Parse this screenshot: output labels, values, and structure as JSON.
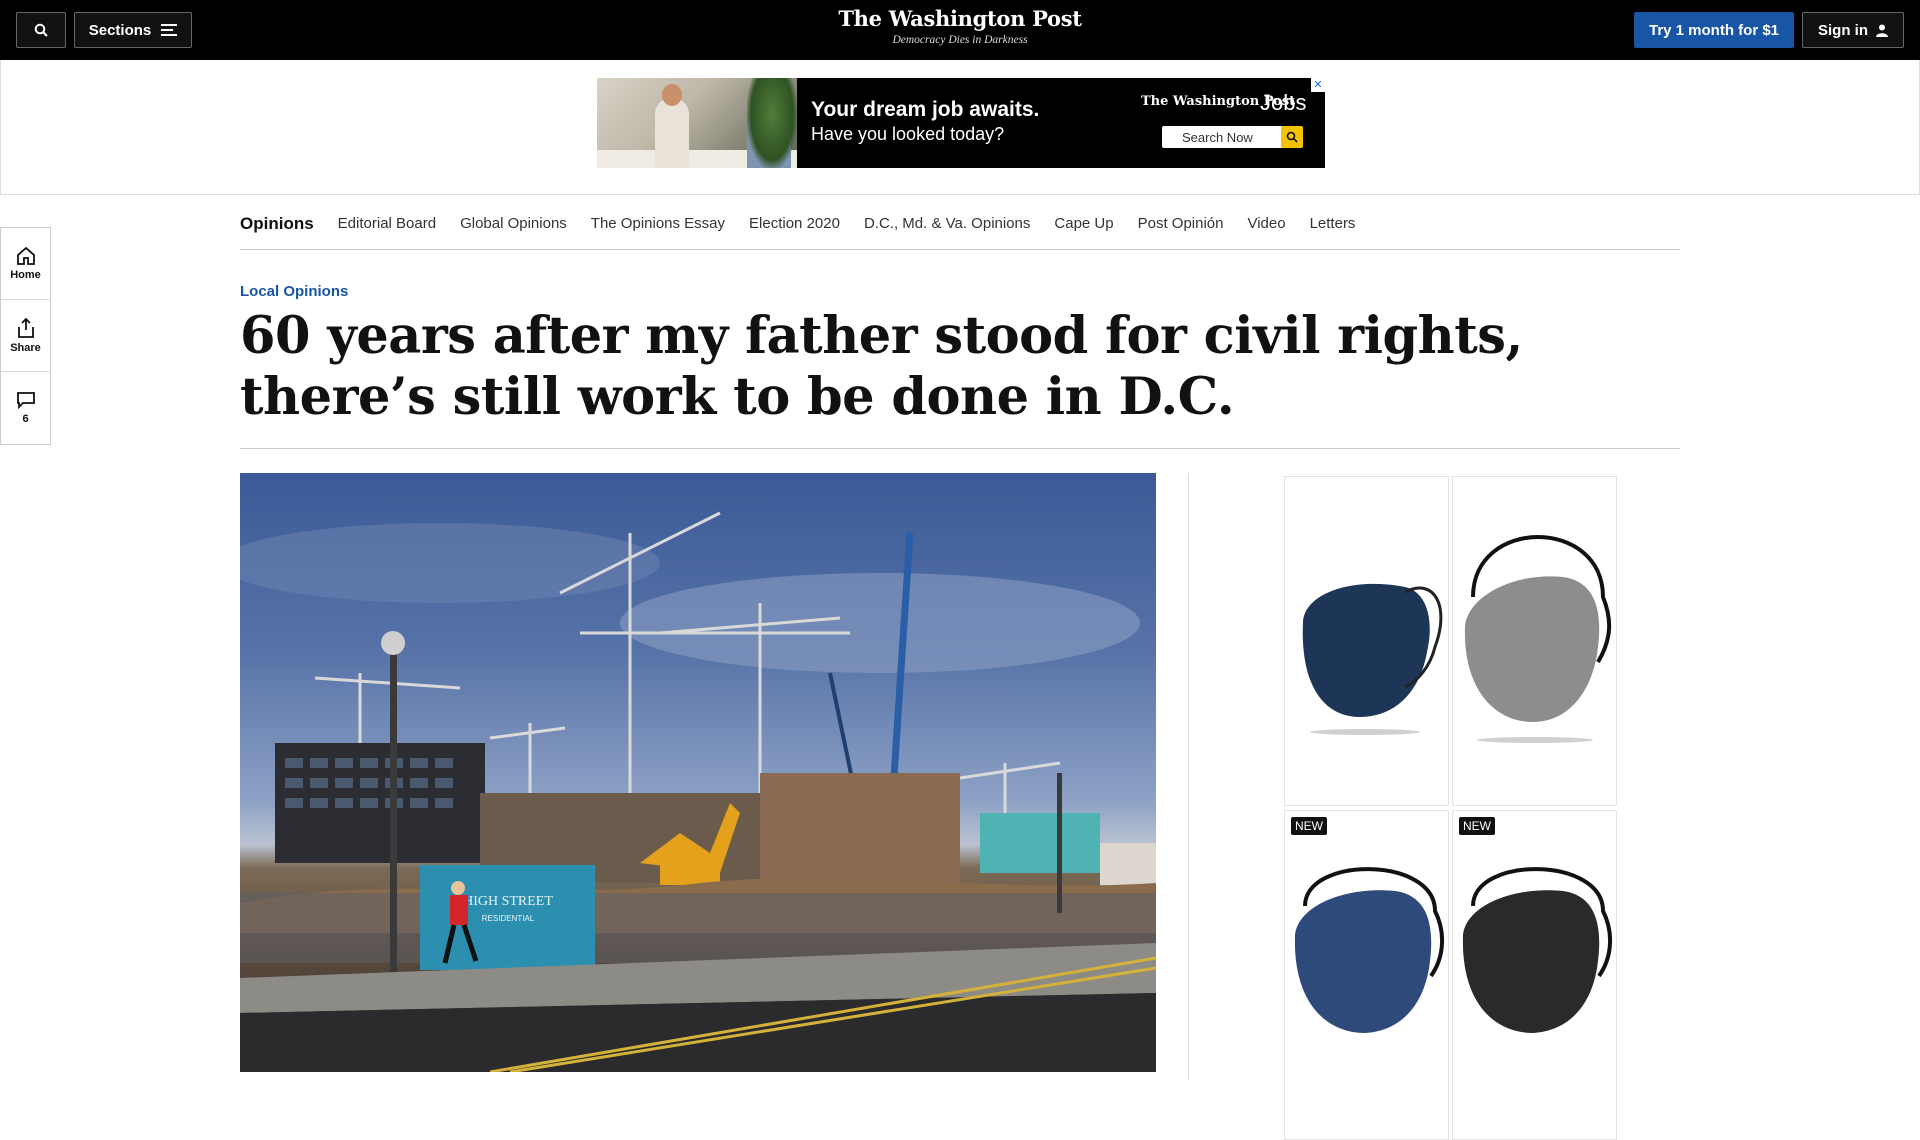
{
  "header": {
    "sections_label": "Sections",
    "logo_name": "The Washington Post",
    "tagline": "Democracy Dies in Darkness",
    "subscribe_label": "Try 1 month for $1",
    "signin_label": "Sign in"
  },
  "top_ad": {
    "headline": "Your dream job awaits.",
    "subline": "Have you looked today?",
    "logo": "The Washington Post",
    "jobs": "Jobs",
    "search_label": "Search Now"
  },
  "rail": {
    "home_label": "Home",
    "share_label": "Share",
    "comments_count": "6"
  },
  "nav": {
    "items": [
      "Opinions",
      "Editorial Board",
      "Global Opinions",
      "The Opinions Essay",
      "Election 2020",
      "D.C., Md. & Va. Opinions",
      "Cape Up",
      "Post Opinión",
      "Video",
      "Letters"
    ]
  },
  "article": {
    "kicker": "Local Opinions",
    "headline": "60 years after my father stood for civil rights, there’s still work to be done in D.C."
  },
  "hero_image": {
    "sign_text": "HIGH STREET",
    "sign_sub": "RESIDENTIAL"
  },
  "side_ad": {
    "badges": [
      "NEW",
      "NEW"
    ],
    "masks": [
      {
        "color": "#1d3557"
      },
      {
        "color": "#8d8d8d"
      },
      {
        "color": "#2e4a7a"
      },
      {
        "color": "#2a2a2a"
      }
    ]
  },
  "colors": {
    "accent": "#1955a5",
    "topbar": "#000000",
    "ad_search_icon": "#f4c400"
  }
}
